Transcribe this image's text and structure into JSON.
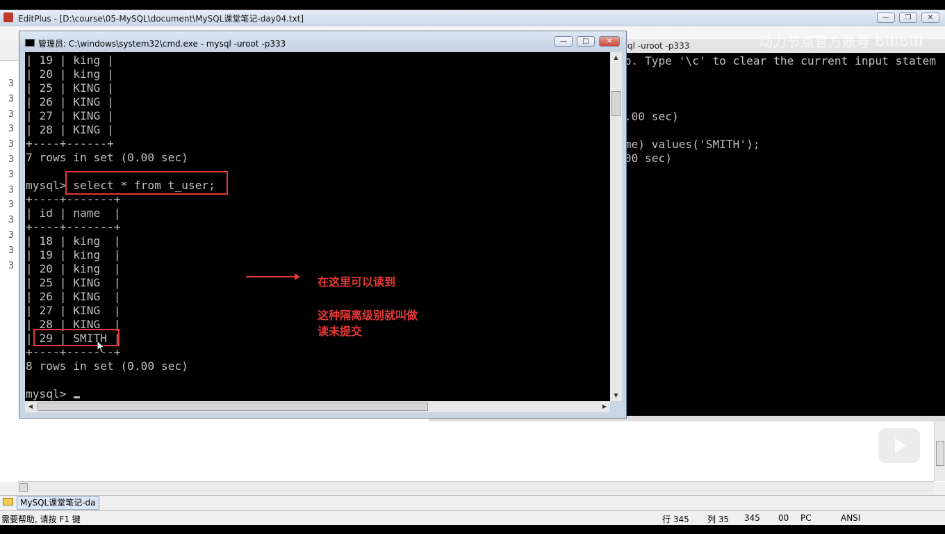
{
  "editplus": {
    "title": "EditPlus - [D:\\course\\05-MySQL\\document\\MySQL课堂笔记-day04.txt]",
    "gutter": [
      "3",
      "3",
      "3",
      "3",
      "3",
      "3",
      "3",
      "3",
      "3",
      "3",
      "3",
      "3",
      "3"
    ],
    "file_tab": "MySQL课堂笔记-da",
    "status": {
      "help": "需要帮助, 请按 F1 键",
      "row": "行 345",
      "col": "列 35",
      "count": "345",
      "ins": "00",
      "os": "PC",
      "enc": "ANSI"
    }
  },
  "back_terminal": {
    "title": "ql  -uroot -p333",
    "lines": [
      ".p. Type '\\c' to clear the current input statem",
      "",
      "",
      "",
      "0.00 sec)",
      "",
      "ame) values('SMITH');",
      " 00 sec)"
    ]
  },
  "cmd": {
    "title": "管理员: C:\\windows\\system32\\cmd.exe - mysql  -uroot -p333",
    "lines": [
      "| 19 | king |",
      "| 20 | king |",
      "| 25 | KING |",
      "| 26 | KING |",
      "| 27 | KING |",
      "| 28 | KING |",
      "+----+------+",
      "7 rows in set (0.00 sec)",
      "",
      "mysql> select * from t_user;",
      "+----+-------+",
      "| id | name  |",
      "+----+-------+",
      "| 18 | king  |",
      "| 19 | king  |",
      "| 20 | king  |",
      "| 25 | KING  |",
      "| 26 | KING  |",
      "| 27 | KING  |",
      "| 28 | KING  |",
      "| 29 | SMITH |",
      "+----+-------+",
      "8 rows in set (0.00 sec)",
      "",
      "mysql> "
    ]
  },
  "annotations": {
    "can_read": "在这里可以读到",
    "isolation_line1": "这种隔离级别就叫做",
    "isolation_line2": "读未提交"
  },
  "watermark": "动力节点官方账号 bilibili",
  "colors": {
    "annotation_red": "#e53935",
    "terminal_text": "#c0c0c0",
    "terminal_bg": "#000000"
  }
}
